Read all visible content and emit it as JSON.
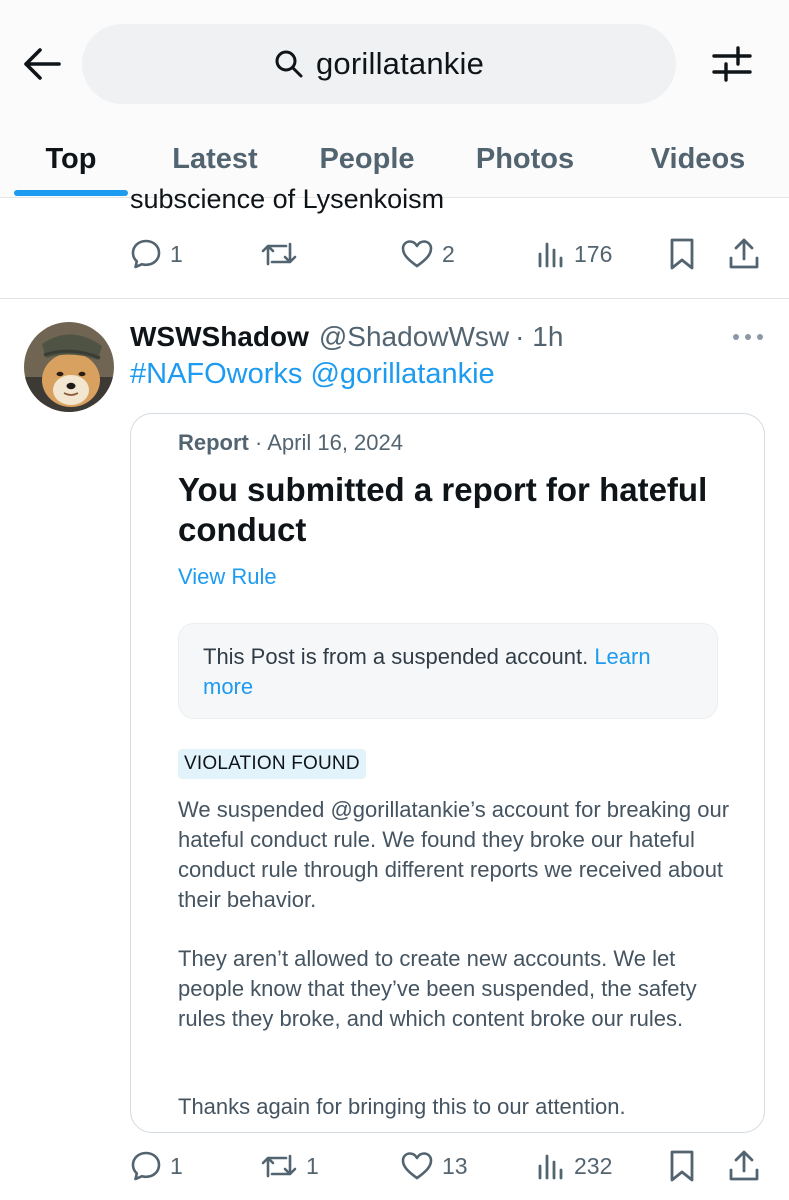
{
  "header": {
    "search_query": "gorillatankie",
    "icons": {
      "back": "arrow-left-icon",
      "search": "search-icon",
      "filter": "sliders-icon"
    }
  },
  "tabs": [
    {
      "label": "Top",
      "active": true
    },
    {
      "label": "Latest",
      "active": false
    },
    {
      "label": "People",
      "active": false
    },
    {
      "label": "Photos",
      "active": false
    },
    {
      "label": "Videos",
      "active": false
    }
  ],
  "accent_color": "#1d9bf0",
  "previous_tweet": {
    "text_tail": "subscience of Lysenkoism",
    "actions": {
      "replies": "1",
      "reposts": "",
      "likes": "2",
      "views": "176"
    }
  },
  "tweet": {
    "display_name": "WSWShadow",
    "handle": "@ShadowWsw",
    "time": "· 1h",
    "hashtag": "#NAFOworks",
    "mention": "@gorillatankie",
    "card": {
      "category": "Report",
      "date": "· April 16, 2024",
      "title": "You submitted a report for hateful conduct",
      "view_rule": "View Rule",
      "notice_text": "This Post is from a suspended account. ",
      "notice_link": "Learn more",
      "badge": "VIOLATION FOUND",
      "paragraph_1": "We suspended @gorillatankie’s account for breaking our hateful conduct rule. We found they broke our hateful conduct rule through different reports we received about their behavior.",
      "paragraph_2": "They aren’t allowed to create new accounts. We let people know that they’ve been suspended, the safety rules they broke, and which content broke our rules.",
      "paragraph_3": "Thanks again for bringing this to our attention."
    },
    "actions": {
      "replies": "1",
      "reposts": "1",
      "likes": "13",
      "views": "232"
    }
  }
}
